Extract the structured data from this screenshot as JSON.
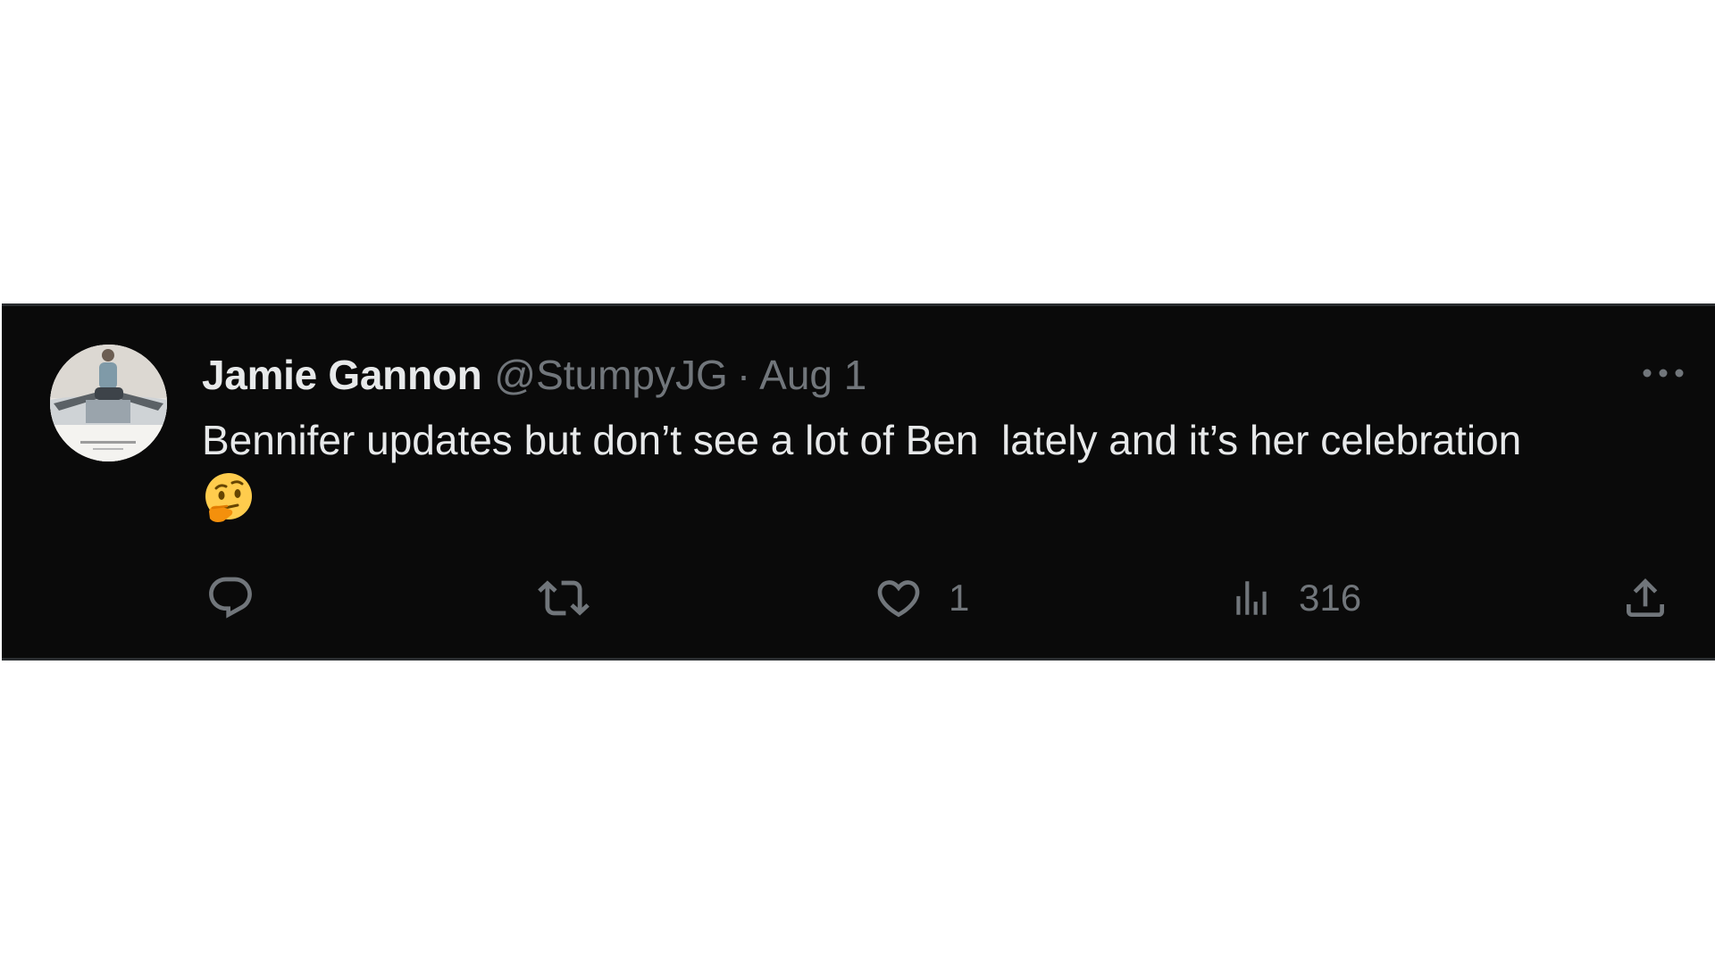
{
  "tweet": {
    "author": {
      "display_name": "Jamie Gannon",
      "handle": "@StumpyJG"
    },
    "separator": "·",
    "date": "Aug 1",
    "text": "Bennifer updates but don’t see a lot of Ben  lately and it’s her celebration ",
    "emoji": "thinking-face-icon",
    "actions": {
      "reply": {
        "icon": "reply-icon",
        "count": ""
      },
      "retweet": {
        "icon": "retweet-icon",
        "count": ""
      },
      "like": {
        "icon": "heart-icon",
        "count": "1"
      },
      "views": {
        "icon": "views-icon",
        "count": "316"
      },
      "share": {
        "icon": "share-icon"
      }
    },
    "more_menu_icon": "more-options-icon"
  },
  "colors": {
    "card_background": "#0a0a0a",
    "primary_text": "#e7e9ea",
    "secondary_text": "#71767b",
    "page_background": "#ffffff"
  }
}
